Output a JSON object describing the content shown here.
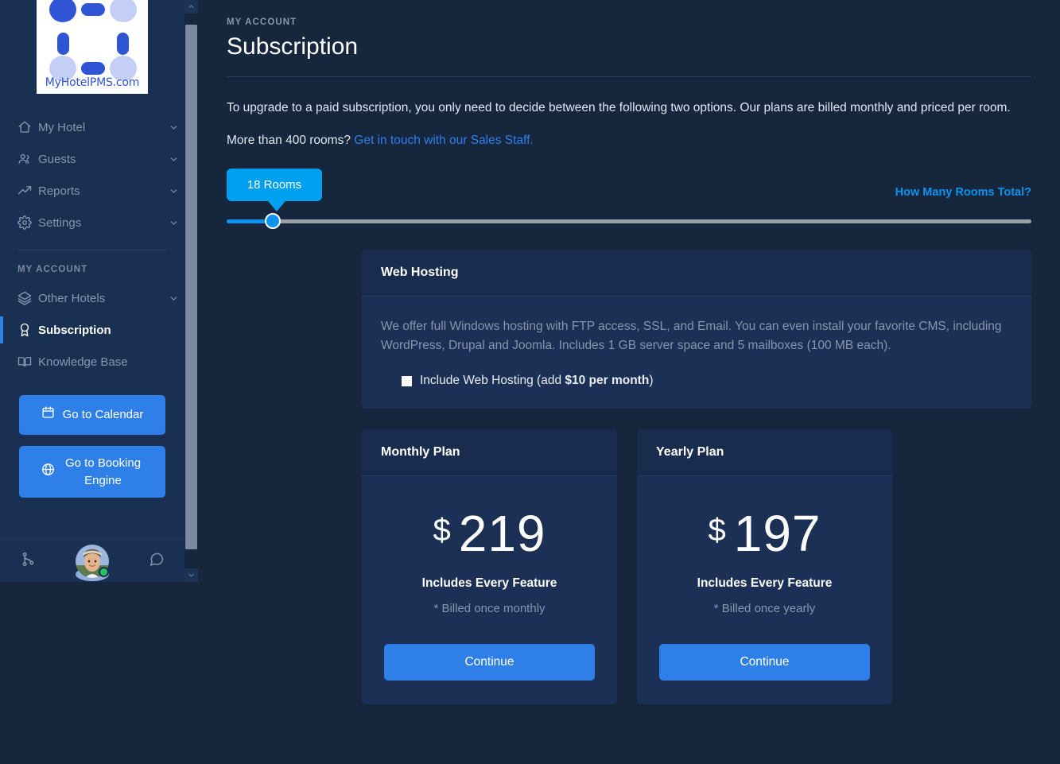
{
  "sidebar": {
    "logo": {
      "text": "MyHotelPMS.com"
    },
    "nav_primary": [
      {
        "label": "My Hotel",
        "icon": "home-icon",
        "chevron": true
      },
      {
        "label": "Guests",
        "icon": "users-icon",
        "chevron": true
      },
      {
        "label": "Reports",
        "icon": "trending-icon",
        "chevron": true
      },
      {
        "label": "Settings",
        "icon": "gear-icon",
        "chevron": true
      }
    ],
    "section_label": "MY ACCOUNT",
    "nav_account": [
      {
        "label": "Other Hotels",
        "icon": "layers-icon",
        "chevron": true,
        "active": false
      },
      {
        "label": "Subscription",
        "icon": "award-icon",
        "chevron": false,
        "active": true
      },
      {
        "label": "Knowledge Base",
        "icon": "book-icon",
        "chevron": false,
        "active": false
      }
    ],
    "buttons": [
      {
        "label": "Go to Calendar",
        "icon": "calendar-icon"
      },
      {
        "label": "Go to Booking Engine",
        "icon": "globe-icon"
      }
    ],
    "footer": {
      "left_icon": "branch-icon",
      "right_icon": "chat-icon",
      "avatar": "user-avatar",
      "status": "online"
    }
  },
  "main": {
    "eyebrow": "MY ACCOUNT",
    "title": "Subscription",
    "intro": "To upgrade to a paid subscription, you only need to decide between the following two options. Our plans are billed monthly and priced per room.",
    "sub_prefix": "More than 400 rooms? ",
    "sub_link": "Get in touch with our Sales Staff."
  },
  "slider": {
    "tooltip": "18 Rooms",
    "help_link": "How Many Rooms Total?",
    "value": 18,
    "min": 1,
    "max": 400,
    "fill_percent": 5
  },
  "hosting_card": {
    "title": "Web Hosting",
    "description": "We offer full Windows hosting with FTP access, SSL, and Email. You can even install your favorite CMS, including WordPress, Drupal and Joomla. Includes 1 GB server space and 5 mailboxes (100 MB each).",
    "checkbox_prefix": "Include Web Hosting (add ",
    "checkbox_price": "$10 per month",
    "checkbox_suffix": ")",
    "checked": false
  },
  "plans": [
    {
      "title": "Monthly Plan",
      "currency": "$",
      "amount": "219",
      "feature": "Includes Every Feature",
      "billed": "* Billed once monthly",
      "cta": "Continue"
    },
    {
      "title": "Yearly Plan",
      "currency": "$",
      "amount": "197",
      "feature": "Includes Every Feature",
      "billed": "* Billed once yearly",
      "cta": "Continue"
    }
  ],
  "colors": {
    "page_bg": "#15263d",
    "sidebar_bg": "#1a3052",
    "card_bg": "#1b3054",
    "card_head_bg": "#192c4d",
    "accent_blue": "#2f7fe8",
    "bright_blue": "#0b93f0",
    "tooltip_blue": "#00a0f0",
    "muted_text": "#8795ad",
    "online_green": "#22c55e"
  }
}
